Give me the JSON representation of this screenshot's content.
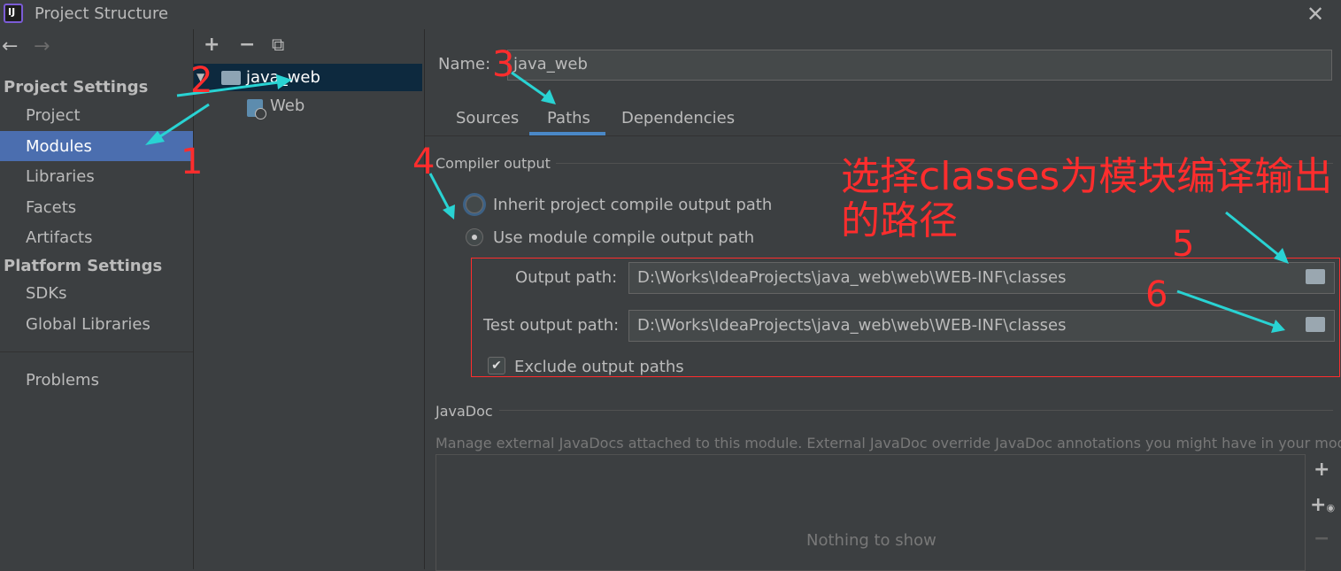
{
  "window": {
    "title": "Project Structure",
    "icon_text": "IJ"
  },
  "sidebar": {
    "project_settings_title": "Project Settings",
    "project_items": [
      "Project",
      "Modules",
      "Libraries",
      "Facets",
      "Artifacts"
    ],
    "platform_settings_title": "Platform Settings",
    "platform_items": [
      "SDKs",
      "Global Libraries"
    ],
    "problems": "Problems"
  },
  "tree": {
    "toolbar": {
      "add": "+",
      "remove": "−",
      "copy": "⧉"
    },
    "module_name": "java_web",
    "facet_name": "Web"
  },
  "module": {
    "name_label": "Name:",
    "name_value": "java_web",
    "tabs": [
      "Sources",
      "Paths",
      "Dependencies"
    ],
    "active_tab": "Paths"
  },
  "compiler_output": {
    "title": "Compiler output",
    "inherit_label": "Inherit project compile output path",
    "use_module_label": "Use module compile output path",
    "output_path_label": "Output path:",
    "output_path_value": "D:\\Works\\IdeaProjects\\java_web\\web\\WEB-INF\\classes",
    "test_output_path_label": "Test output path:",
    "test_output_path_value": "D:\\Works\\IdeaProjects\\java_web\\web\\WEB-INF\\classes",
    "exclude_label": "Exclude output paths",
    "exclude_checked": true
  },
  "javadoc": {
    "title": "JavaDoc",
    "description": "Manage external JavaDocs attached to this module. External JavaDoc override JavaDoc annotations you might have in your module.",
    "empty_text": "Nothing to show"
  },
  "annotations": {
    "n1": "1",
    "n2": "2",
    "n3": "3",
    "n4": "4",
    "n5": "5",
    "n6": "6",
    "note_line1": "选择classes为模块编译输出",
    "note_line2": "的路径",
    "color": "#ff2d2d",
    "arrow_color": "#29d3d3"
  }
}
